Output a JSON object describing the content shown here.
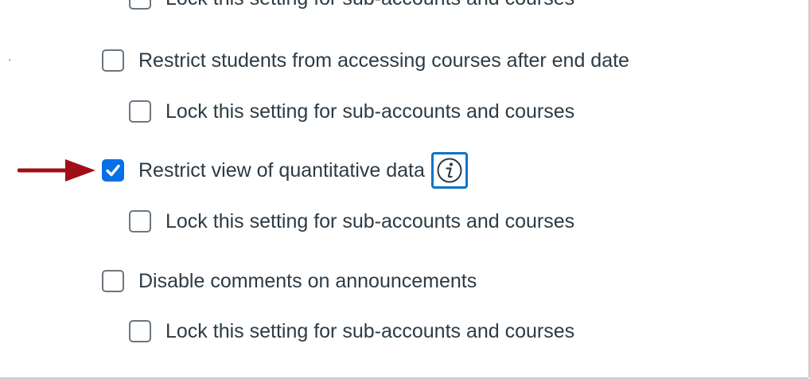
{
  "settings": {
    "clipped_lock_label": "Lock this setting for sub-accounts and courses",
    "restrict_end_date": {
      "label": "Restrict students from accessing courses after end date",
      "checked": false,
      "lock_label": "Lock this setting for sub-accounts and courses",
      "lock_checked": false
    },
    "restrict_quantitative": {
      "label": "Restrict view of quantitative data",
      "checked": true,
      "info_icon": "info-icon",
      "lock_label": "Lock this setting for sub-accounts and courses",
      "lock_checked": false
    },
    "disable_comments": {
      "label": "Disable comments on announcements",
      "checked": false,
      "lock_label": "Lock this setting for sub-accounts and courses",
      "lock_checked": false
    }
  },
  "colors": {
    "checkbox_checked": "#0770e6",
    "info_border": "#0b74c9",
    "arrow": "#a00f17",
    "text": "#2d3b45"
  }
}
